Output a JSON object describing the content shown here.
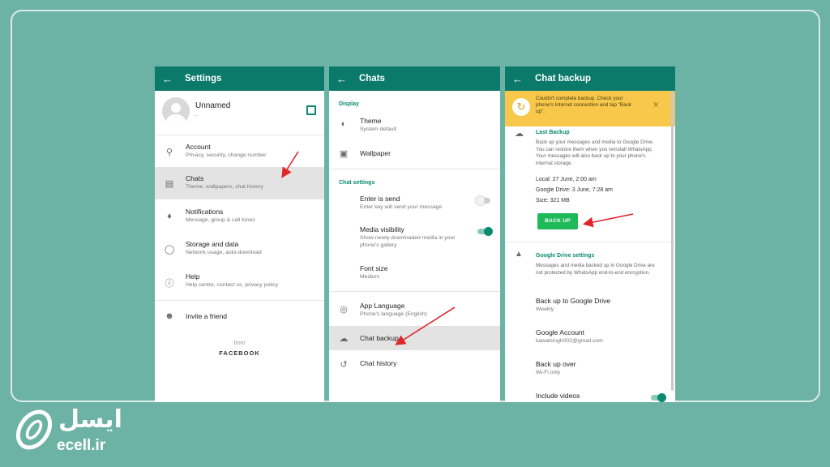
{
  "colors": {
    "background": "#6db3a5",
    "appbar": "#0b7a6b",
    "accent": "#0b8a6f",
    "banner": "#f7c84a",
    "button": "#1fb95a",
    "arrow": "#e0262a"
  },
  "settings": {
    "title": "Settings",
    "profile_name": "Unnamed",
    "profile_status": ".",
    "items": [
      {
        "label": "Account",
        "sub": "Privacy, security, change number",
        "icon": "key-icon"
      },
      {
        "label": "Chats",
        "sub": "Theme, wallpapers, chat history",
        "icon": "chat-icon"
      },
      {
        "label": "Notifications",
        "sub": "Message, group & call tones",
        "icon": "bell-icon"
      },
      {
        "label": "Storage and data",
        "sub": "Network usage, auto-download",
        "icon": "storage-icon"
      },
      {
        "label": "Help",
        "sub": "Help centre, contact us, privacy policy",
        "icon": "help-icon"
      }
    ],
    "invite": "Invite a friend",
    "from": "from",
    "facebook": "FACEBOOK"
  },
  "chats": {
    "title": "Chats",
    "display_section": "Display",
    "theme_label": "Theme",
    "theme_sub": "System default",
    "wallpaper_label": "Wallpaper",
    "chat_settings_section": "Chat settings",
    "enter_label": "Enter is send",
    "enter_sub": "Enter key will send your message",
    "media_label": "Media visibility",
    "media_sub": "Show newly downloaded media in your phone's gallery",
    "font_label": "Font size",
    "font_sub": "Medium",
    "lang_label": "App Language",
    "lang_sub": "Phone's language (English)",
    "backup_label": "Chat backup",
    "history_label": "Chat history"
  },
  "backup": {
    "title": "Chat backup",
    "banner_text": "Couldn't complete backup. Check your phone's Internet connection and tap \"Back up\".",
    "last_backup_section": "Last Backup",
    "last_backup_desc": "Back up your messages and media to Google Drive. You can restore them when you reinstall WhatsApp. Your messages will also back up to your phone's internal storage.",
    "local": "Local: 27 June, 2:00 am",
    "google_drive": "Google Drive: 3 June, 7:28 am",
    "size": "Size: 321 MB",
    "backup_button": "BACK UP",
    "gd_section": "Google Drive settings",
    "gd_desc": "Messages and media backed up in Google Drive are not protected by WhatsApp end-to-end encryption.",
    "backup_to_label": "Back up to Google Drive",
    "backup_to_sub": "Weekly",
    "account_label": "Google Account",
    "account_sub": "kawalsingh002@gmail.com",
    "over_label": "Back up over",
    "over_sub": "Wi-Fi only",
    "videos_label": "Include videos"
  },
  "brand": {
    "name_fa": "ایسل",
    "domain": "ecell.ir"
  }
}
